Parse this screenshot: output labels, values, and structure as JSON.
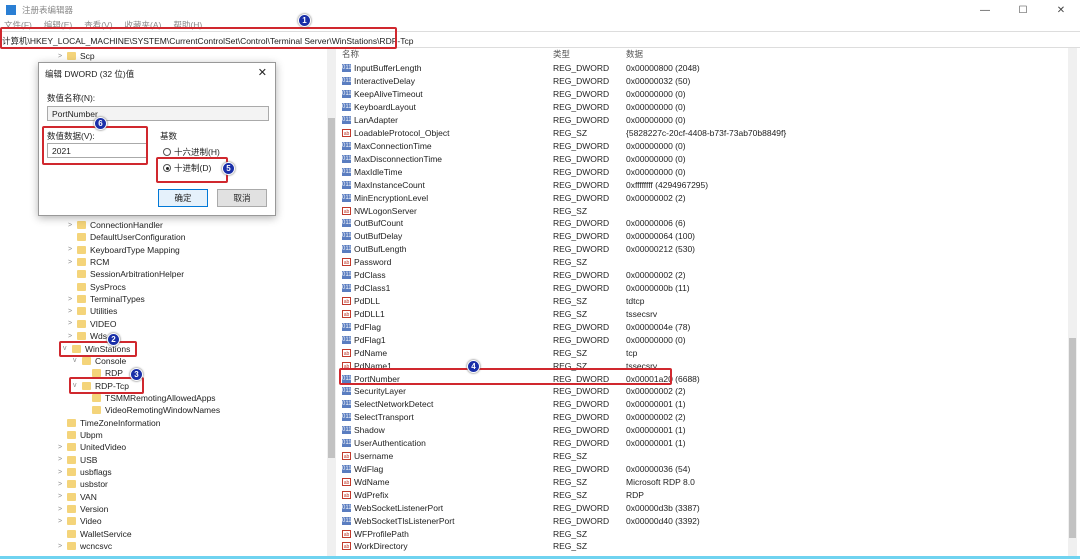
{
  "window": {
    "title": "注册表编辑器",
    "controls": [
      "—",
      "☐",
      "✕"
    ]
  },
  "menu": [
    "文件(F)",
    "编辑(E)",
    "查看(V)",
    "收藏夹(A)",
    "帮助(H)"
  ],
  "address": "计算机\\HKEY_LOCAL_MACHINE\\SYSTEM\\CurrentControlSet\\Control\\Terminal Server\\WinStations\\RDP-Tcp",
  "tree": [
    {
      "label": "Scp",
      "level": 1,
      "arrow": ">"
    },
    {
      "label": "ConnectionHandler",
      "level": 2,
      "arrow": ">"
    },
    {
      "label": "DefaultUserConfiguration",
      "level": 2,
      "arrow": ""
    },
    {
      "label": "KeyboardType Mapping",
      "level": 2,
      "arrow": ">"
    },
    {
      "label": "RCM",
      "level": 2,
      "arrow": ">"
    },
    {
      "label": "SessionArbitrationHelper",
      "level": 2,
      "arrow": ""
    },
    {
      "label": "SysProcs",
      "level": 2,
      "arrow": ""
    },
    {
      "label": "TerminalTypes",
      "level": 2,
      "arrow": ">"
    },
    {
      "label": "Utilities",
      "level": 2,
      "arrow": ">"
    },
    {
      "label": "VIDEO",
      "level": 2,
      "arrow": ">"
    },
    {
      "label": "Wds",
      "level": 2,
      "arrow": ">"
    },
    {
      "label": "WinStations",
      "level": 1.5,
      "arrow": "v"
    },
    {
      "label": "Console",
      "level": 2.5,
      "arrow": "v"
    },
    {
      "label": "RDP",
      "level": 3.5,
      "arrow": ""
    },
    {
      "label": "RDP-Tcp",
      "level": 2.5,
      "arrow": "v"
    },
    {
      "label": "TSMMRemotingAllowedApps",
      "level": 3.5,
      "arrow": ""
    },
    {
      "label": "VideoRemotingWindowNames",
      "level": 3.5,
      "arrow": ""
    },
    {
      "label": "TimeZoneInformation",
      "level": 1,
      "arrow": ""
    },
    {
      "label": "Ubpm",
      "level": 1,
      "arrow": ""
    },
    {
      "label": "UnitedVideo",
      "level": 1,
      "arrow": ">"
    },
    {
      "label": "USB",
      "level": 1,
      "arrow": ">"
    },
    {
      "label": "usbflags",
      "level": 1,
      "arrow": ">"
    },
    {
      "label": "usbstor",
      "level": 1,
      "arrow": ">"
    },
    {
      "label": "VAN",
      "level": 1,
      "arrow": ">"
    },
    {
      "label": "Version",
      "level": 1,
      "arrow": ">"
    },
    {
      "label": "Video",
      "level": 1,
      "arrow": ">"
    },
    {
      "label": "WalletService",
      "level": 1,
      "arrow": ""
    },
    {
      "label": "wcncsvc",
      "level": 1,
      "arrow": ">"
    }
  ],
  "list": {
    "headers": [
      "名称",
      "类型",
      "数据"
    ],
    "rows": [
      [
        "dw",
        "InputBufferLength",
        "REG_DWORD",
        "0x00000800 (2048)"
      ],
      [
        "dw",
        "InteractiveDelay",
        "REG_DWORD",
        "0x00000032 (50)"
      ],
      [
        "dw",
        "KeepAliveTimeout",
        "REG_DWORD",
        "0x00000000 (0)"
      ],
      [
        "dw",
        "KeyboardLayout",
        "REG_DWORD",
        "0x00000000 (0)"
      ],
      [
        "dw",
        "LanAdapter",
        "REG_DWORD",
        "0x00000000 (0)"
      ],
      [
        "sz",
        "LoadableProtocol_Object",
        "REG_SZ",
        "{5828227c-20cf-4408-b73f-73ab70b8849f}"
      ],
      [
        "dw",
        "MaxConnectionTime",
        "REG_DWORD",
        "0x00000000 (0)"
      ],
      [
        "dw",
        "MaxDisconnectionTime",
        "REG_DWORD",
        "0x00000000 (0)"
      ],
      [
        "dw",
        "MaxIdleTime",
        "REG_DWORD",
        "0x00000000 (0)"
      ],
      [
        "dw",
        "MaxInstanceCount",
        "REG_DWORD",
        "0xffffffff (4294967295)"
      ],
      [
        "dw",
        "MinEncryptionLevel",
        "REG_DWORD",
        "0x00000002 (2)"
      ],
      [
        "sz",
        "NWLogonServer",
        "REG_SZ",
        ""
      ],
      [
        "dw",
        "OutBufCount",
        "REG_DWORD",
        "0x00000006 (6)"
      ],
      [
        "dw",
        "OutBufDelay",
        "REG_DWORD",
        "0x00000064 (100)"
      ],
      [
        "dw",
        "OutBufLength",
        "REG_DWORD",
        "0x00000212 (530)"
      ],
      [
        "sz",
        "Password",
        "REG_SZ",
        ""
      ],
      [
        "dw",
        "PdClass",
        "REG_DWORD",
        "0x00000002 (2)"
      ],
      [
        "dw",
        "PdClass1",
        "REG_DWORD",
        "0x0000000b (11)"
      ],
      [
        "sz",
        "PdDLL",
        "REG_SZ",
        "tdtcp"
      ],
      [
        "sz",
        "PdDLL1",
        "REG_SZ",
        "tssecsrv"
      ],
      [
        "dw",
        "PdFlag",
        "REG_DWORD",
        "0x0000004e (78)"
      ],
      [
        "dw",
        "PdFlag1",
        "REG_DWORD",
        "0x00000000 (0)"
      ],
      [
        "sz",
        "PdName",
        "REG_SZ",
        "tcp"
      ],
      [
        "sz",
        "PdName1",
        "REG_SZ",
        "tssecsrv"
      ],
      [
        "dw",
        "PortNumber",
        "REG_DWORD",
        "0x00001a20 (6688)"
      ],
      [
        "dw",
        "SecurityLayer",
        "REG_DWORD",
        "0x00000002 (2)"
      ],
      [
        "dw",
        "SelectNetworkDetect",
        "REG_DWORD",
        "0x00000001 (1)"
      ],
      [
        "dw",
        "SelectTransport",
        "REG_DWORD",
        "0x00000002 (2)"
      ],
      [
        "dw",
        "Shadow",
        "REG_DWORD",
        "0x00000001 (1)"
      ],
      [
        "dw",
        "UserAuthentication",
        "REG_DWORD",
        "0x00000001 (1)"
      ],
      [
        "sz",
        "Username",
        "REG_SZ",
        ""
      ],
      [
        "dw",
        "WdFlag",
        "REG_DWORD",
        "0x00000036 (54)"
      ],
      [
        "sz",
        "WdName",
        "REG_SZ",
        "Microsoft RDP 8.0"
      ],
      [
        "sz",
        "WdPrefix",
        "REG_SZ",
        "RDP"
      ],
      [
        "dw",
        "WebSocketListenerPort",
        "REG_DWORD",
        "0x00000d3b (3387)"
      ],
      [
        "dw",
        "WebSocketTlsListenerPort",
        "REG_DWORD",
        "0x00000d40 (3392)"
      ],
      [
        "sz",
        "WFProfilePath",
        "REG_SZ",
        ""
      ],
      [
        "sz",
        "WorkDirectory",
        "REG_SZ",
        ""
      ]
    ]
  },
  "icons": {
    "dw": "011",
    "sz": "ab"
  },
  "dialog": {
    "title": "编辑 DWORD (32 位)值",
    "close": "✕",
    "name_label": "数值名称(N):",
    "name_value": "PortNumber",
    "data_label": "数值数据(V):",
    "data_value": "2021",
    "base_label": "基数",
    "hex_label": "十六进制(H)",
    "dec_label": "十进制(D)",
    "selected_base": "decimal",
    "ok": "确定",
    "cancel": "取消"
  },
  "annotations": [
    "1",
    "2",
    "3",
    "4",
    "5",
    "6"
  ],
  "colors": {
    "annotation_box": "#d0282e",
    "badge": "#1a2fa8"
  }
}
